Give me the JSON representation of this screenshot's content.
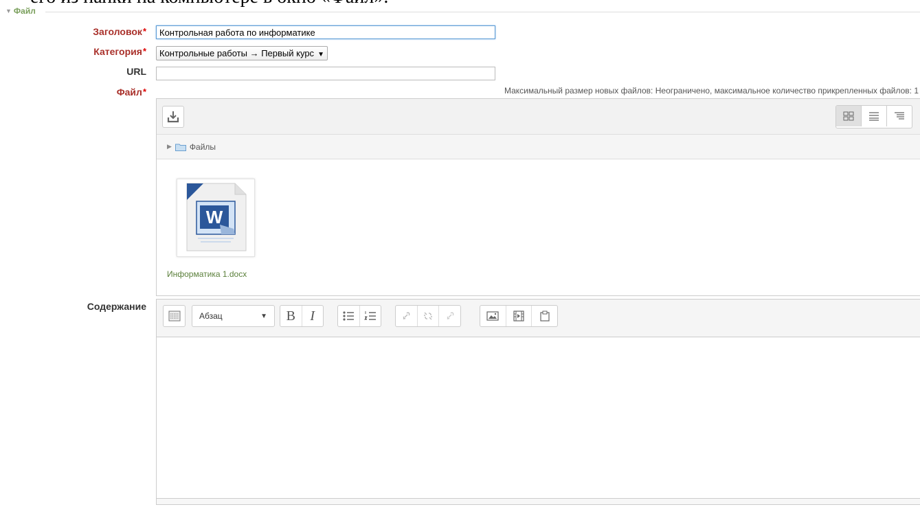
{
  "doc_text": "его из папки на компьютере в окно «Файл».",
  "section": {
    "legend": "Файл"
  },
  "form": {
    "title_label": "Заголовок",
    "title_value": "Контрольная работа по информатике",
    "category_label": "Категория",
    "category_value": "Контрольные работы → Первый курс",
    "url_label": "URL",
    "url_value": "",
    "file_label": "Файл",
    "required_mark": "*",
    "content_label": "Содержание"
  },
  "filepicker": {
    "max_size_note": "Максимальный размер новых файлов: Неограничено, максимальное количество прикрепленных файлов: 1",
    "path_folder": "Файлы",
    "files": [
      {
        "name": "Информатика 1.docx",
        "icon": "word-document-icon"
      }
    ],
    "view_modes": [
      "icons-view",
      "list-view",
      "tree-view"
    ],
    "active_view": "icons-view"
  },
  "editor": {
    "paragraph_format": "Абзац",
    "bold_label": "B",
    "italic_label": "I"
  },
  "colors": {
    "required": "#a9302a",
    "legend": "#7a9f5c",
    "file_link": "#5a7f3a",
    "word_blue": "#2b579a"
  }
}
